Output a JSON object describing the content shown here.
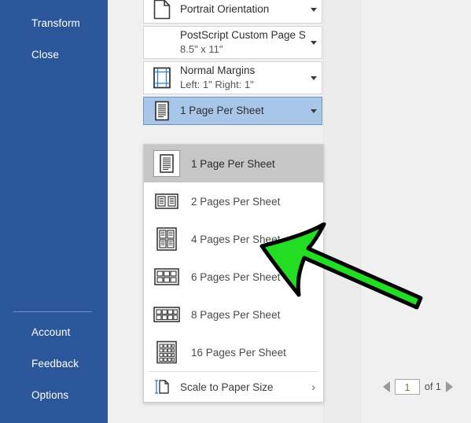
{
  "sidebar": {
    "bg_color": "#2b579a",
    "items_top": [
      {
        "label": "Transform",
        "name": "transform"
      },
      {
        "label": "Close",
        "name": "close"
      }
    ],
    "items_bottom": [
      {
        "label": "Account",
        "name": "account"
      },
      {
        "label": "Feedback",
        "name": "feedback"
      },
      {
        "label": "Options",
        "name": "options"
      }
    ]
  },
  "settings": {
    "orientation": {
      "title": "Portrait Orientation",
      "sub": "",
      "icon": "page-portrait-icon"
    },
    "page_size": {
      "title": "PostScript Custom Page Size",
      "sub": "8.5\" x 11\"",
      "icon": "page-size-icon"
    },
    "margins": {
      "title": "Normal Margins",
      "sub": "Left:  1\"   Right:  1\"",
      "icon": "margins-icon"
    },
    "pages_per_sheet": {
      "title": "1 Page Per Sheet",
      "sub": "",
      "icon": "one-page-per-sheet-icon",
      "selected": true,
      "highlight_color": "#a8c6e8"
    }
  },
  "dropdown": {
    "options": [
      {
        "label": "1 Page Per Sheet",
        "icon": "one-page-per-sheet-icon",
        "highlighted": true
      },
      {
        "label": "2 Pages Per Sheet",
        "icon": "two-pages-per-sheet-icon",
        "highlighted": false
      },
      {
        "label": "4 Pages Per Sheet",
        "icon": "four-pages-per-sheet-icon",
        "highlighted": false
      },
      {
        "label": "6 Pages Per Sheet",
        "icon": "six-pages-per-sheet-icon",
        "highlighted": false
      },
      {
        "label": "8 Pages Per Sheet",
        "icon": "eight-pages-per-sheet-icon",
        "highlighted": false
      },
      {
        "label": "16 Pages Per Sheet",
        "icon": "sixteen-pages-per-sheet-icon",
        "highlighted": false
      }
    ],
    "scale_to_paper_size": {
      "label": "Scale to Paper Size",
      "icon": "scale-to-paper-size-icon",
      "submenu_arrow": "›"
    }
  },
  "page_nav": {
    "prev_icon": "prev-page-arrow-icon",
    "next_icon": "next-page-arrow-icon",
    "current_page": "1",
    "total_label": "of 1"
  },
  "annotation": {
    "arrow": {
      "name": "green-pointer-arrow",
      "fill_color": "#22dd22",
      "stroke_color": "#000000",
      "direction": "up-left"
    }
  }
}
